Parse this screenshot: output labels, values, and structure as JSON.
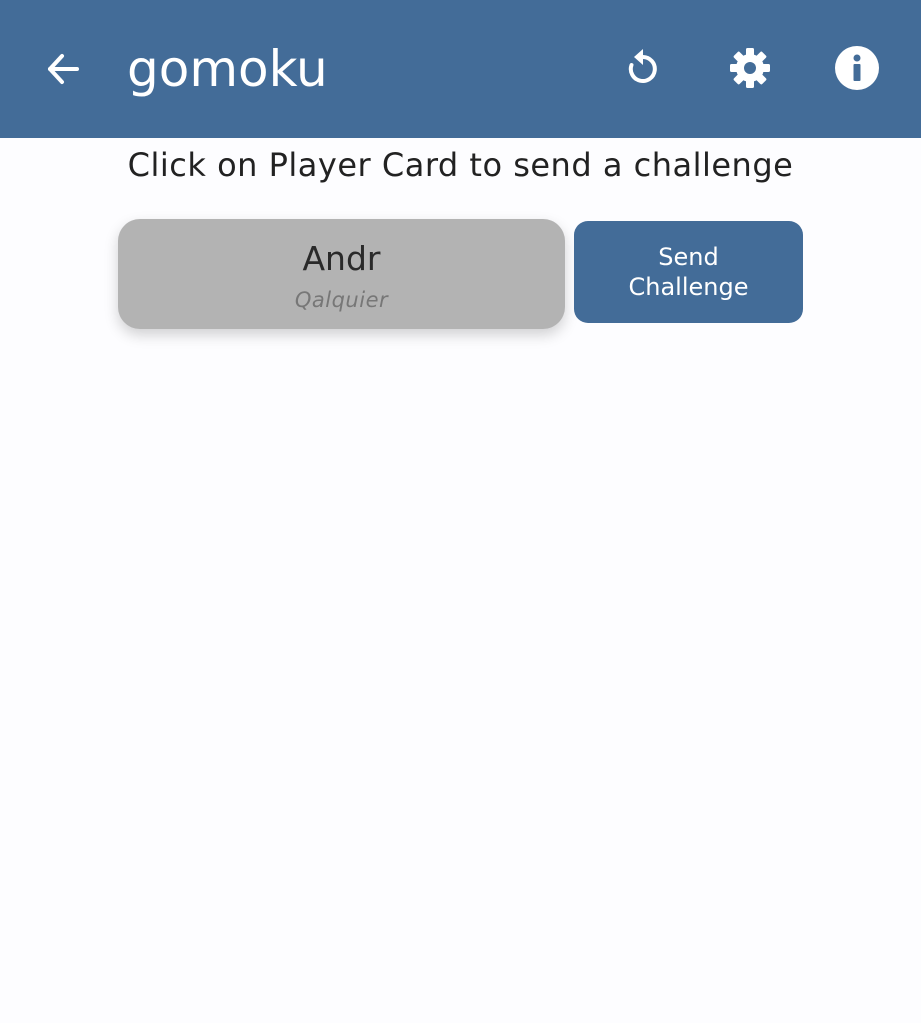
{
  "appbar": {
    "title": "gomoku",
    "back_icon": "arrow-left-icon",
    "actions": [
      {
        "icon": "refresh-icon"
      },
      {
        "icon": "gear-icon"
      },
      {
        "icon": "info-icon"
      }
    ],
    "background_color": "#436c98"
  },
  "main": {
    "instruction": "Click on Player Card to send a challenge",
    "player_card": {
      "name": "Andr",
      "subtitle": "Qalquier",
      "background_color": "#b3b3b3"
    },
    "send_button": {
      "label": "Send\nChallenge",
      "background_color": "#436c98"
    }
  }
}
